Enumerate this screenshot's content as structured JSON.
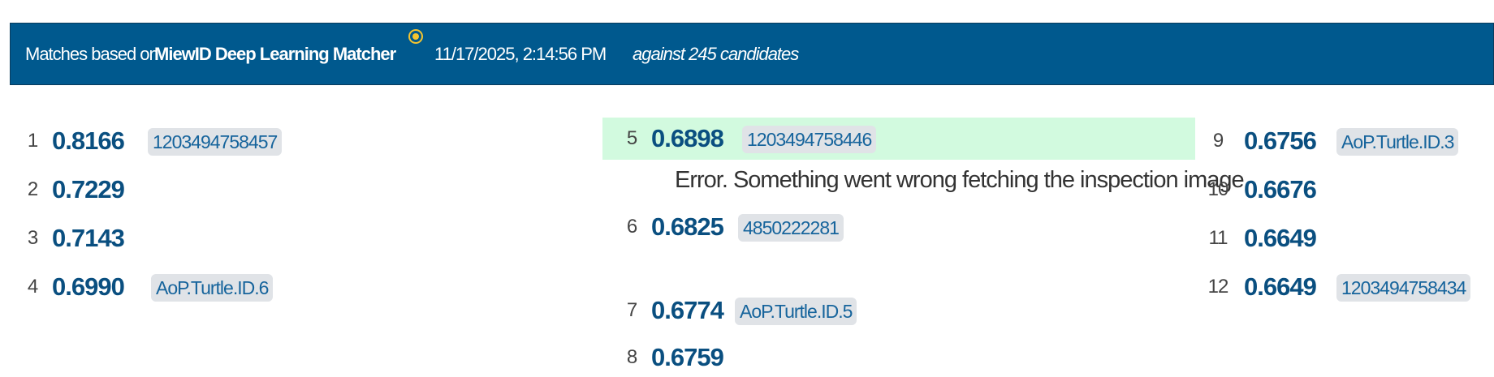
{
  "header": {
    "prefix": "Matches based on",
    "algorithm": "MiewID Deep Learning Matcher",
    "timestamp": "11/17/2025, 2:14:56 PM",
    "candidates": "against 245 candidates",
    "status_icon": "radio-dot-icon"
  },
  "matches": [
    {
      "rank": "1",
      "score": "0.8166",
      "id": "1203494758457"
    },
    {
      "rank": "2",
      "score": "0.7229"
    },
    {
      "rank": "3",
      "score": "0.7143"
    },
    {
      "rank": "4",
      "score": "0.6990",
      "id": "AoP.Turtle.ID.6"
    },
    {
      "rank": "5",
      "score": "0.6898",
      "id": "1203494758446",
      "selected": true
    },
    {
      "rank": "6",
      "score": "0.6825",
      "id": "4850222281"
    },
    {
      "rank": "7",
      "score": "0.6774",
      "id": "AoP.Turtle.ID.5"
    },
    {
      "rank": "8",
      "score": "0.6759"
    },
    {
      "rank": "9",
      "score": "0.6756",
      "id": "AoP.Turtle.ID.3"
    },
    {
      "rank": "10",
      "score": "0.6676"
    },
    {
      "rank": "11",
      "score": "0.6649"
    },
    {
      "rank": "12",
      "score": "0.6649",
      "id": "1203494758434"
    }
  ],
  "error": {
    "message": "Error. Something went wrong fetching the inspection image"
  },
  "colors": {
    "header_bg": "#00598e",
    "score": "#0a4f80",
    "selected_bg": "#d2fadf",
    "status_dot": "#f4c430"
  }
}
